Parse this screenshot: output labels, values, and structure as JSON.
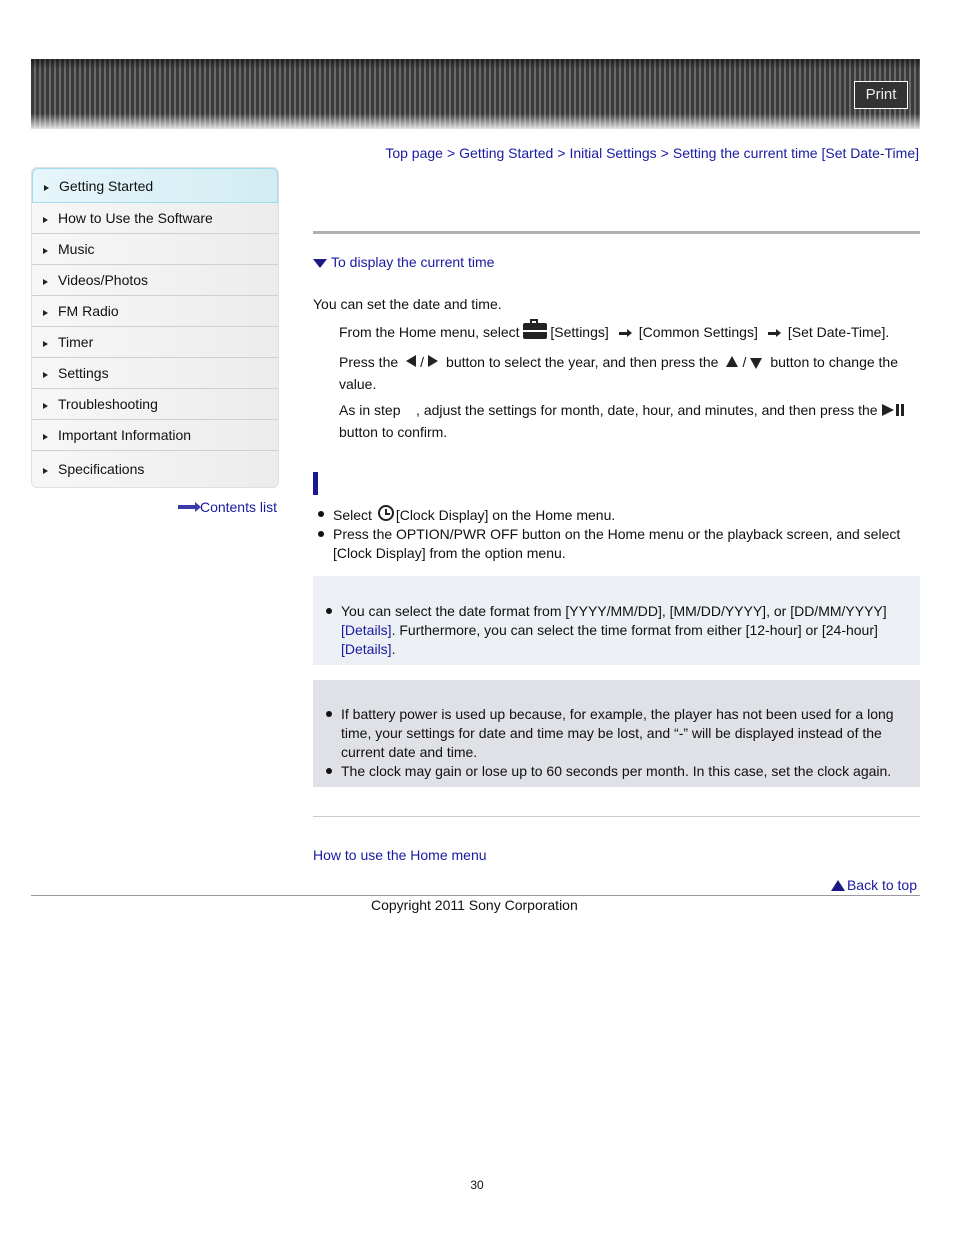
{
  "header": {
    "print_label": "Print"
  },
  "breadcrumb": {
    "items": [
      "Top page",
      "Getting Started",
      "Initial Settings",
      "Setting the current time [Set Date-Time]"
    ],
    "separator": ">"
  },
  "sidebar": {
    "items": [
      {
        "label": "Getting Started",
        "active": true
      },
      {
        "label": "How to Use the Software"
      },
      {
        "label": "Music"
      },
      {
        "label": "Videos/Photos"
      },
      {
        "label": "FM Radio"
      },
      {
        "label": "Timer"
      },
      {
        "label": "Settings"
      },
      {
        "label": "Troubleshooting"
      },
      {
        "label": "Important Information"
      },
      {
        "label": "Specifications"
      }
    ],
    "contents_list_label": "Contents list"
  },
  "main": {
    "toc_link": "To display the current time",
    "intro": "You can set the date and time.",
    "step1": {
      "prefix": "From the Home menu, select ",
      "settings": "[Settings]",
      "common": "[Common Settings]",
      "set_date": "[Set Date-Time]."
    },
    "step2": {
      "prefix": "Press the",
      "slash": "/",
      "middle": "button to select the year, and then press the",
      "suffix": "button to change the value."
    },
    "step3": {
      "prefix": "As in step    , adjust the settings for month, date, hour, and minutes, and then press the",
      "suffix": "button to confirm."
    },
    "display_section": {
      "items": [
        {
          "prefix": "Select ",
          "suffix": "[Clock Display] on the Home menu."
        },
        {
          "text": "Press the OPTION/PWR OFF button on the Home menu or the playback screen, and select [Clock Display] from the option menu."
        }
      ]
    },
    "hint": {
      "part1": "You can select the date format from [YYYY/MM/DD], [MM/DD/YYYY], or [DD/MM/YYYY] ",
      "details1": "[Details]",
      "part2": ". Furthermore, you can select the time format from either [12-hour] or [24-hour] ",
      "details2": "[Details]",
      "part3": "."
    },
    "notes": [
      "If battery power is used up because, for example, the player has not been used for a long time, your settings for date and time may be lost, and “-” will be displayed instead of the current date and time.",
      "The clock may gain or lose up to 60 seconds per month. In this case, set the clock again."
    ],
    "related_link": "How to use the Home menu",
    "back_to_top": "Back to top"
  },
  "footer": {
    "copyright": "Copyright 2011 Sony Corporation",
    "page_number": "30"
  },
  "colors": {
    "link": "#1a1aa0",
    "hint_bg": "#eceff4",
    "note_bg": "#dfe1e6",
    "sidebar_active": "#d2ecf2"
  }
}
